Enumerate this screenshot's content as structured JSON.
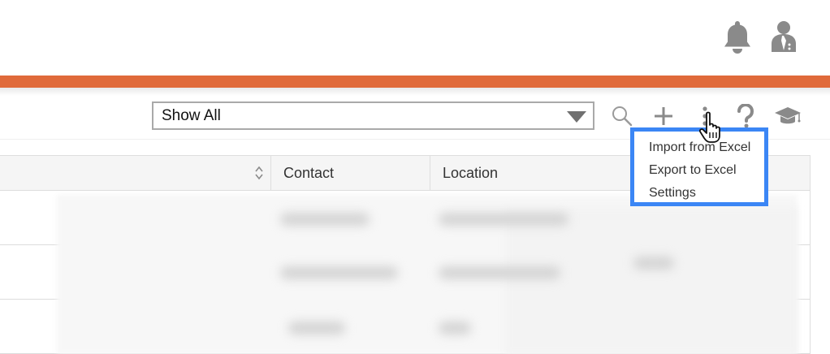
{
  "colors": {
    "accent": "#e06a3a",
    "menu_border": "#3b86f5",
    "icon_gray": "#8a8a8a"
  },
  "header": {
    "icons": [
      "bell-icon",
      "user-icon"
    ]
  },
  "toolbar": {
    "filter": {
      "selected": "Show All"
    },
    "icons": [
      "search-icon",
      "plus-icon",
      "more-vertical-icon",
      "help-icon",
      "graduation-cap-icon"
    ]
  },
  "table": {
    "columns": [
      "",
      "Contact",
      "Location"
    ]
  },
  "menu": {
    "items": [
      "Import from Excel",
      "Export to Excel",
      "Settings"
    ]
  }
}
